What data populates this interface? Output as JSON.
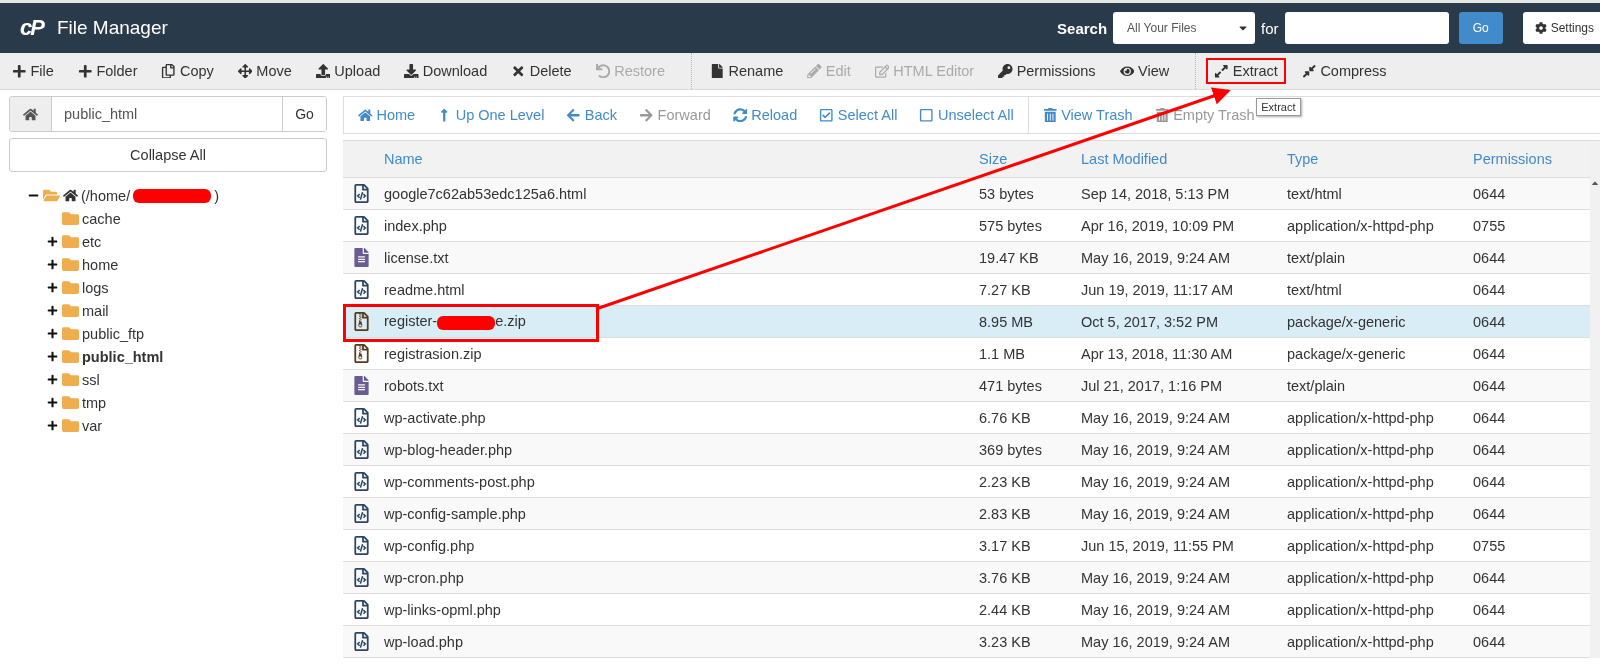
{
  "header": {
    "logo": "cP",
    "title": "File Manager",
    "search_label": "Search",
    "search_scope": "All Your Files",
    "for_label": "for",
    "go": "Go",
    "settings": "Settings"
  },
  "toolbar": {
    "groups": [
      [
        {
          "label": "File",
          "disabled": false
        },
        {
          "label": "Folder",
          "disabled": false
        },
        {
          "label": "Copy",
          "disabled": false
        },
        {
          "label": "Move",
          "disabled": false
        },
        {
          "label": "Upload",
          "disabled": false
        },
        {
          "label": "Download",
          "disabled": false
        },
        {
          "label": "Delete",
          "disabled": false
        },
        {
          "label": "Restore",
          "disabled": true
        }
      ],
      [
        {
          "label": "Rename",
          "disabled": false
        },
        {
          "label": "Edit",
          "disabled": true
        },
        {
          "label": "HTML Editor",
          "disabled": true
        },
        {
          "label": "Permissions",
          "disabled": false
        },
        {
          "label": "View",
          "disabled": false
        }
      ],
      [
        {
          "label": "Extract",
          "disabled": false,
          "highlighted": true,
          "tooltip": "Extract"
        },
        {
          "label": "Compress",
          "disabled": false,
          "highlighted": false
        }
      ]
    ]
  },
  "path_bar": {
    "value": "public_html",
    "go": "Go"
  },
  "collapse_all": "Collapse All",
  "tree": [
    {
      "label": "(/home/",
      "redacted": true,
      "label_end": ")",
      "expanded": true,
      "selected": false,
      "children": [
        {
          "label": "cache",
          "selected": false
        },
        {
          "label": "etc",
          "expanded": false,
          "selected": false
        },
        {
          "label": "home",
          "expanded": false,
          "selected": false
        },
        {
          "label": "logs",
          "expanded": false,
          "selected": false
        },
        {
          "label": "mail",
          "expanded": false,
          "selected": false
        },
        {
          "label": "public_ftp",
          "expanded": false,
          "selected": false
        },
        {
          "label": "public_html",
          "expanded": false,
          "selected": true
        },
        {
          "label": "ssl",
          "expanded": false,
          "selected": false
        },
        {
          "label": "tmp",
          "expanded": false,
          "selected": false
        },
        {
          "label": "var",
          "expanded": false,
          "selected": false
        }
      ]
    }
  ],
  "nav": {
    "groups": [
      [
        {
          "label": "Home",
          "disabled": false
        },
        {
          "label": "Up One Level",
          "disabled": false
        },
        {
          "label": "Back",
          "disabled": false
        },
        {
          "label": "Forward",
          "disabled": true
        },
        {
          "label": "Reload",
          "disabled": false
        },
        {
          "label": "Select All",
          "disabled": false
        },
        {
          "label": "Unselect All",
          "disabled": false
        }
      ],
      [
        {
          "label": "View Trash",
          "disabled": false
        },
        {
          "label": "Empty Trash",
          "disabled": true
        }
      ]
    ]
  },
  "table": {
    "columns": [
      "Name",
      "Size",
      "Last Modified",
      "Type",
      "Permissions"
    ],
    "rows": [
      {
        "kind": "code",
        "name": "google7c62ab53edc125a6.html",
        "size": "53 bytes",
        "modified": "Sep 14, 2018, 5:13 PM",
        "type": "text/html",
        "permissions": "0644",
        "selected": false
      },
      {
        "kind": "code",
        "name": "index.php",
        "size": "575 bytes",
        "modified": "Apr 16, 2019, 10:09 PM",
        "type": "application/x-httpd-php",
        "permissions": "0755",
        "selected": false
      },
      {
        "kind": "text",
        "name": "license.txt",
        "size": "19.47 KB",
        "modified": "May 16, 2019, 9:24 AM",
        "type": "text/plain",
        "permissions": "0644",
        "selected": false
      },
      {
        "kind": "code",
        "name": "readme.html",
        "size": "7.27 KB",
        "modified": "Jun 19, 2019, 11:17 AM",
        "type": "text/html",
        "permissions": "0644",
        "selected": false
      },
      {
        "kind": "zip",
        "name": "register-",
        "redacted": true,
        "name_end": "e.zip",
        "size": "8.95 MB",
        "modified": "Oct 5, 2017, 3:52 PM",
        "type": "package/x-generic",
        "permissions": "0644",
        "selected": true,
        "highlighted": true
      },
      {
        "kind": "zip",
        "name": "registrasion.zip",
        "size": "1.1 MB",
        "modified": "Apr 13, 2018, 11:30 AM",
        "type": "package/x-generic",
        "permissions": "0644",
        "selected": false
      },
      {
        "kind": "text",
        "name": "robots.txt",
        "size": "471 bytes",
        "modified": "Jul 21, 2017, 1:16 PM",
        "type": "text/plain",
        "permissions": "0644",
        "selected": false
      },
      {
        "kind": "code",
        "name": "wp-activate.php",
        "size": "6.76 KB",
        "modified": "May 16, 2019, 9:24 AM",
        "type": "application/x-httpd-php",
        "permissions": "0644",
        "selected": false
      },
      {
        "kind": "code",
        "name": "wp-blog-header.php",
        "size": "369 bytes",
        "modified": "May 16, 2019, 9:24 AM",
        "type": "application/x-httpd-php",
        "permissions": "0644",
        "selected": false
      },
      {
        "kind": "code",
        "name": "wp-comments-post.php",
        "size": "2.23 KB",
        "modified": "May 16, 2019, 9:24 AM",
        "type": "application/x-httpd-php",
        "permissions": "0644",
        "selected": false
      },
      {
        "kind": "code",
        "name": "wp-config-sample.php",
        "size": "2.83 KB",
        "modified": "May 16, 2019, 9:24 AM",
        "type": "application/x-httpd-php",
        "permissions": "0644",
        "selected": false
      },
      {
        "kind": "code",
        "name": "wp-config.php",
        "size": "3.17 KB",
        "modified": "Jun 15, 2019, 11:55 PM",
        "type": "application/x-httpd-php",
        "permissions": "0755",
        "selected": false
      },
      {
        "kind": "code",
        "name": "wp-cron.php",
        "size": "3.76 KB",
        "modified": "May 16, 2019, 9:24 AM",
        "type": "application/x-httpd-php",
        "permissions": "0644",
        "selected": false
      },
      {
        "kind": "code",
        "name": "wp-links-opml.php",
        "size": "2.44 KB",
        "modified": "May 16, 2019, 9:24 AM",
        "type": "application/x-httpd-php",
        "permissions": "0644",
        "selected": false
      },
      {
        "kind": "code",
        "name": "wp-load.php",
        "size": "3.23 KB",
        "modified": "May 16, 2019, 9:24 AM",
        "type": "application/x-httpd-php",
        "permissions": "0644",
        "selected": false
      }
    ]
  },
  "annotation_arrow": true
}
